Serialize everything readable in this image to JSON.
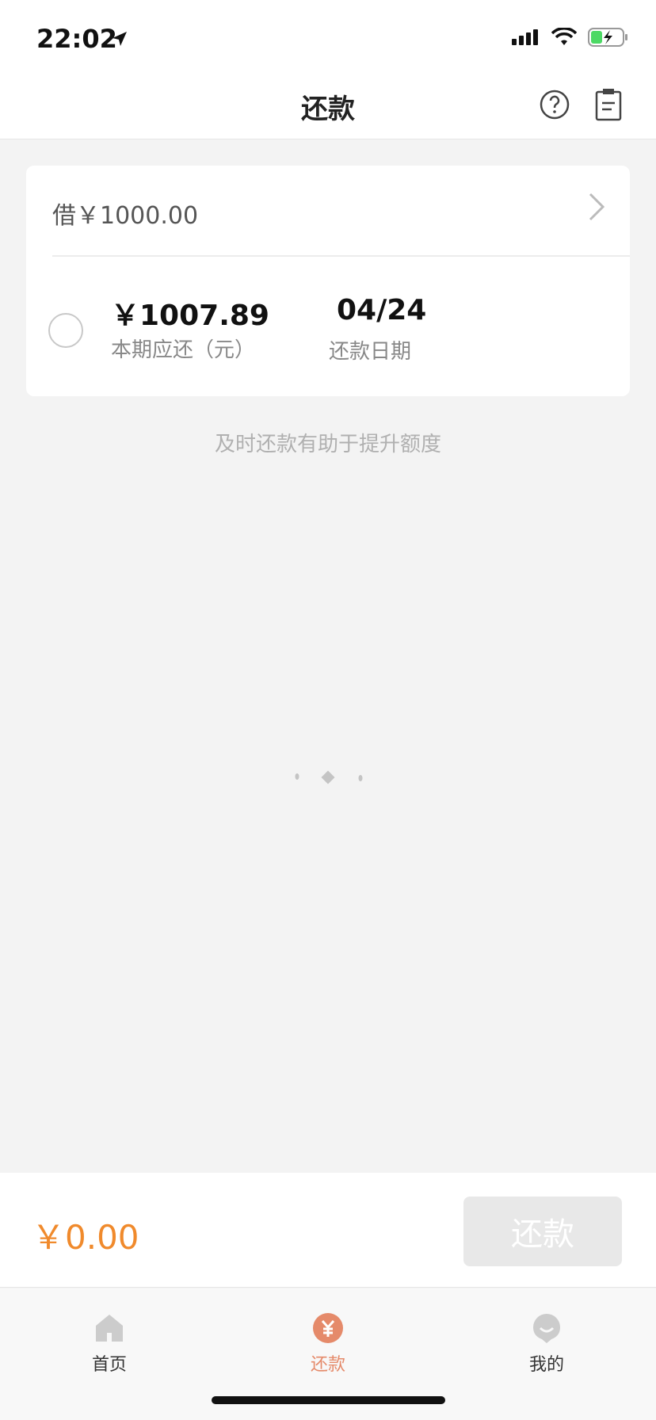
{
  "status_bar": {
    "time": "22:02"
  },
  "nav": {
    "title": "还款",
    "help_icon": "help-icon",
    "bill_icon": "bill-icon"
  },
  "loan": {
    "label": "借￥1000.00"
  },
  "installment": {
    "amount": "￥1007.89",
    "amount_label": "本期应还（元）",
    "date": "04/24",
    "date_label": "还款日期"
  },
  "tip": "及时还款有助于提升额度",
  "pay_bar": {
    "total": "￥0.00",
    "button_label": "还款"
  },
  "tabs": [
    {
      "label": "首页",
      "icon": "home-icon"
    },
    {
      "label": "还款",
      "icon": "repay-icon",
      "active": true
    },
    {
      "label": "我的",
      "icon": "profile-icon"
    }
  ],
  "colors": {
    "accent": "#f08a2c",
    "tab_active": "#e58a6a",
    "button_disabled": "#e8e8e8"
  }
}
